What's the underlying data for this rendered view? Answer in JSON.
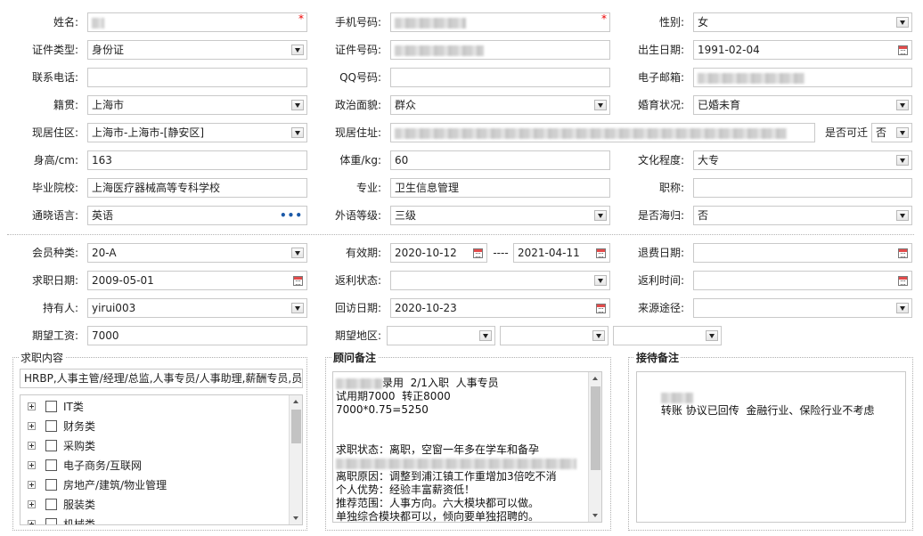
{
  "row1": {
    "name_label": "姓名:",
    "mobile_label": "手机号码:",
    "gender_label": "性别:",
    "gender_value": "女",
    "required_mark": "*"
  },
  "row2": {
    "idtype_label": "证件类型:",
    "idtype_value": "身份证",
    "idno_label": "证件号码:",
    "birth_label": "出生日期:",
    "birth_value": "1991-02-04"
  },
  "row3": {
    "phone_label": "联系电话:",
    "qq_label": "QQ号码:",
    "email_label": "电子邮箱:"
  },
  "row4": {
    "native_label": "籍贯:",
    "native_value": "上海市",
    "political_label": "政治面貌:",
    "political_value": "群众",
    "marital_label": "婚育状况:",
    "marital_value": "已婚未育"
  },
  "row5": {
    "residence_label": "现居住区:",
    "residence_value": "上海市-上海市-[静安区]",
    "address_label": "现居住址:",
    "relocate_label": "是否可迁",
    "relocate_value": "否"
  },
  "row6": {
    "height_label": "身高/cm:",
    "height_value": "163",
    "weight_label": "体重/kg:",
    "weight_value": "60",
    "education_label": "文化程度:",
    "education_value": "大专"
  },
  "row7": {
    "school_label": "毕业院校:",
    "school_value": "上海医疗器械高等专科学校",
    "major_label": "专业:",
    "major_value": "卫生信息管理",
    "title_label": "职称:"
  },
  "row8": {
    "language_label": "通晓语言:",
    "language_value": "英语",
    "language_more": "•••",
    "level_label": "外语等级:",
    "level_value": "三级",
    "returnee_label": "是否海归:",
    "returnee_value": "否"
  },
  "member": {
    "type_label": "会员种类:",
    "type_value": "20-A",
    "valid_label": "有效期:",
    "valid_from": "2020-10-12",
    "valid_sep": "----",
    "valid_to": "2021-04-11",
    "refund_label": "退费日期:",
    "jobdate_label": "求职日期:",
    "jobdate_value": "2009-05-01",
    "rebate_state_label": "返利状态:",
    "rebate_time_label": "返利时间:",
    "holder_label": "持有人:",
    "holder_value": "yirui003",
    "visit_label": "回访日期:",
    "visit_value": "2020-10-23",
    "source_label": "来源途径:",
    "salary_label": "期望工资:",
    "salary_value": "7000",
    "area_label": "期望地区:"
  },
  "job_panel": {
    "title": "求职内容",
    "summary": "HRBP,人事主管/经理/总监,人事专员/人事助理,薪酬专员,员",
    "categories": [
      "IT类",
      "财务类",
      "采购类",
      "电子商务/互联网",
      "房地产/建筑/物业管理",
      "服装类",
      "机械类"
    ]
  },
  "advisor_panel": {
    "title": "顾问备注",
    "lines": [
      "录用  2/1入职  人事专员",
      "试用期7000  转正8000",
      "7000*0.75=5250",
      "",
      "",
      "求职状态：离职，空窗一年多在学车和备孕",
      "",
      "离职原因：调整到浦江镇工作重增加3倍吃不消",
      "个人优势：经验丰富薪资低！",
      "推荐范围：人事方向。六大模块都可以做。",
      "单独综合模块都可以，倾向要单独招聘的。"
    ]
  },
  "reception_panel": {
    "title": "接待备注",
    "text": "转账 协议已回传  金融行业、保险行业不考虑"
  }
}
